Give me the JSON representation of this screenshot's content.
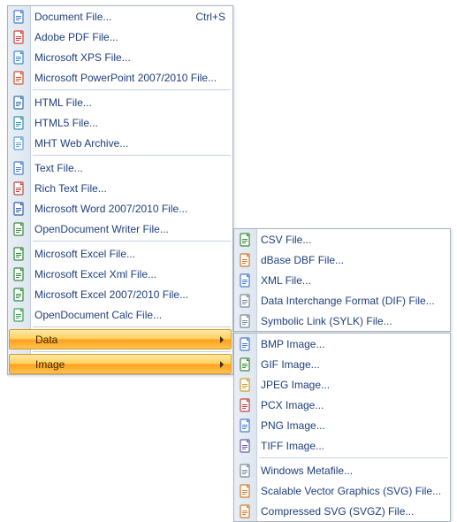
{
  "main_menu": {
    "items": [
      {
        "label": "Document File...",
        "shortcut": "Ctrl+S",
        "icon": "doc"
      },
      {
        "label": "Adobe PDF File...",
        "icon": "pdf"
      },
      {
        "label": "Microsoft XPS File...",
        "icon": "xps"
      },
      {
        "label": "Microsoft PowerPoint 2007/2010 File...",
        "icon": "pptx"
      },
      {
        "sep": true
      },
      {
        "label": "HTML File...",
        "icon": "html"
      },
      {
        "label": "HTML5 File...",
        "icon": "html5"
      },
      {
        "label": "MHT Web Archive...",
        "icon": "mht"
      },
      {
        "sep": true
      },
      {
        "label": "Text File...",
        "icon": "txt"
      },
      {
        "label": "Rich Text File...",
        "icon": "rtf"
      },
      {
        "label": "Microsoft Word 2007/2010 File...",
        "icon": "docx"
      },
      {
        "label": "OpenDocument Writer File...",
        "icon": "odt"
      },
      {
        "sep": true
      },
      {
        "label": "Microsoft Excel File...",
        "icon": "xls"
      },
      {
        "label": "Microsoft Excel Xml File...",
        "icon": "xlsx"
      },
      {
        "label": "Microsoft Excel 2007/2010 File...",
        "icon": "xlsx2"
      },
      {
        "label": "OpenDocument Calc File...",
        "icon": "ods"
      },
      {
        "sep": true
      },
      {
        "label": "Data",
        "submenu": true,
        "highlighted": true
      },
      {
        "sep": true
      },
      {
        "label": "Image",
        "submenu": true,
        "highlighted": true
      }
    ]
  },
  "data_menu": {
    "items": [
      {
        "label": "CSV File...",
        "icon": "csv"
      },
      {
        "label": "dBase DBF File...",
        "icon": "dbf"
      },
      {
        "label": "XML File...",
        "icon": "xml"
      },
      {
        "label": "Data Interchange Format (DIF) File...",
        "icon": "dif"
      },
      {
        "label": "Symbolic Link (SYLK) File...",
        "icon": "sylk"
      }
    ]
  },
  "image_menu": {
    "items": [
      {
        "label": "BMP Image...",
        "icon": "bmp"
      },
      {
        "label": "GIF Image...",
        "icon": "gif"
      },
      {
        "label": "JPEG Image...",
        "icon": "jpeg"
      },
      {
        "label": "PCX Image...",
        "icon": "pcx"
      },
      {
        "label": "PNG Image...",
        "icon": "png"
      },
      {
        "label": "TIFF Image...",
        "icon": "tiff"
      },
      {
        "sep": true
      },
      {
        "label": "Windows Metafile...",
        "icon": "wmf"
      },
      {
        "label": "Scalable Vector Graphics (SVG) File...",
        "icon": "svg"
      },
      {
        "label": "Compressed SVG (SVGZ) File...",
        "icon": "svgz"
      }
    ]
  },
  "icon_colors": {
    "doc": "#4a7dce",
    "pdf": "#d44138",
    "xps": "#3a8dd0",
    "pptx": "#d35230",
    "html": "#2f6fb0",
    "html5": "#2f8fb0",
    "mht": "#5aa0d0",
    "txt": "#4a7dce",
    "rtf": "#c04545",
    "docx": "#2f5fa8",
    "odt": "#3a8a3a",
    "xls": "#2f8a3a",
    "xlsx": "#2f8a3a",
    "xlsx2": "#2f8a3a",
    "ods": "#3aa04a",
    "csv": "#3a8a3a",
    "dbf": "#d07a2a",
    "xml": "#4a7dce",
    "dif": "#7a8a9a",
    "sylk": "#7a8a9a",
    "bmp": "#4a7dce",
    "gif": "#3a8a3a",
    "jpeg": "#c9a030",
    "pcx": "#c04545",
    "png": "#4a7dce",
    "tiff": "#6a5da8",
    "wmf": "#7a8a9a",
    "svg": "#d07a2a",
    "svgz": "#d07a2a"
  }
}
